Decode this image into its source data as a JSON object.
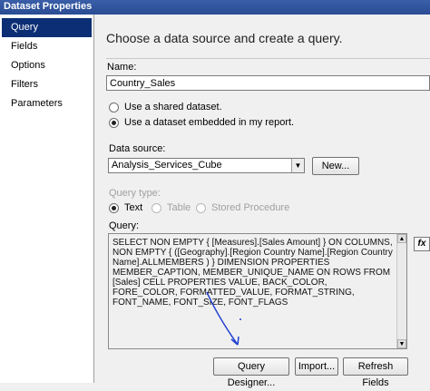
{
  "window": {
    "title": "Dataset Properties"
  },
  "nav": {
    "items": [
      {
        "label": "Query",
        "selected": true
      },
      {
        "label": "Fields"
      },
      {
        "label": "Options"
      },
      {
        "label": "Filters"
      },
      {
        "label": "Parameters"
      }
    ]
  },
  "main": {
    "heading": "Choose a data source and create a query.",
    "name_label": "Name:",
    "name_value": "Country_Sales",
    "radio_shared": "Use a shared dataset.",
    "radio_embedded": "Use a dataset embedded in my report.",
    "selected_radio": "embedded",
    "datasource_label": "Data source:",
    "datasource_value": "Analysis_Services_Cube",
    "new_button": "New...",
    "query_type_label": "Query type:",
    "query_types": {
      "text": "Text",
      "table": "Table",
      "stored_procedure": "Stored Procedure"
    },
    "selected_query_type": "text",
    "query_label": "Query:",
    "query_text": "SELECT NON EMPTY { [Measures].[Sales Amount] } ON COLUMNS, NON EMPTY { ([Geography].[Region Country Name].[Region Country Name].ALLMEMBERS ) } DIMENSION PROPERTIES MEMBER_CAPTION, MEMBER_UNIQUE_NAME ON ROWS FROM [Sales] CELL PROPERTIES VALUE, BACK_COLOR, FORE_COLOR, FORMATTED_VALUE, FORMAT_STRING, FONT_NAME, FONT_SIZE, FONT_FLAGS",
    "fx_button": "fx",
    "buttons": {
      "query_designer": "Query Designer...",
      "import": "Import...",
      "refresh_fields": "Refresh Fields"
    }
  },
  "colors": {
    "nav_selected_bg": "#0b2e74",
    "title_bar": "#2a4c93",
    "annotation_arrow": "#1f3fd0"
  }
}
